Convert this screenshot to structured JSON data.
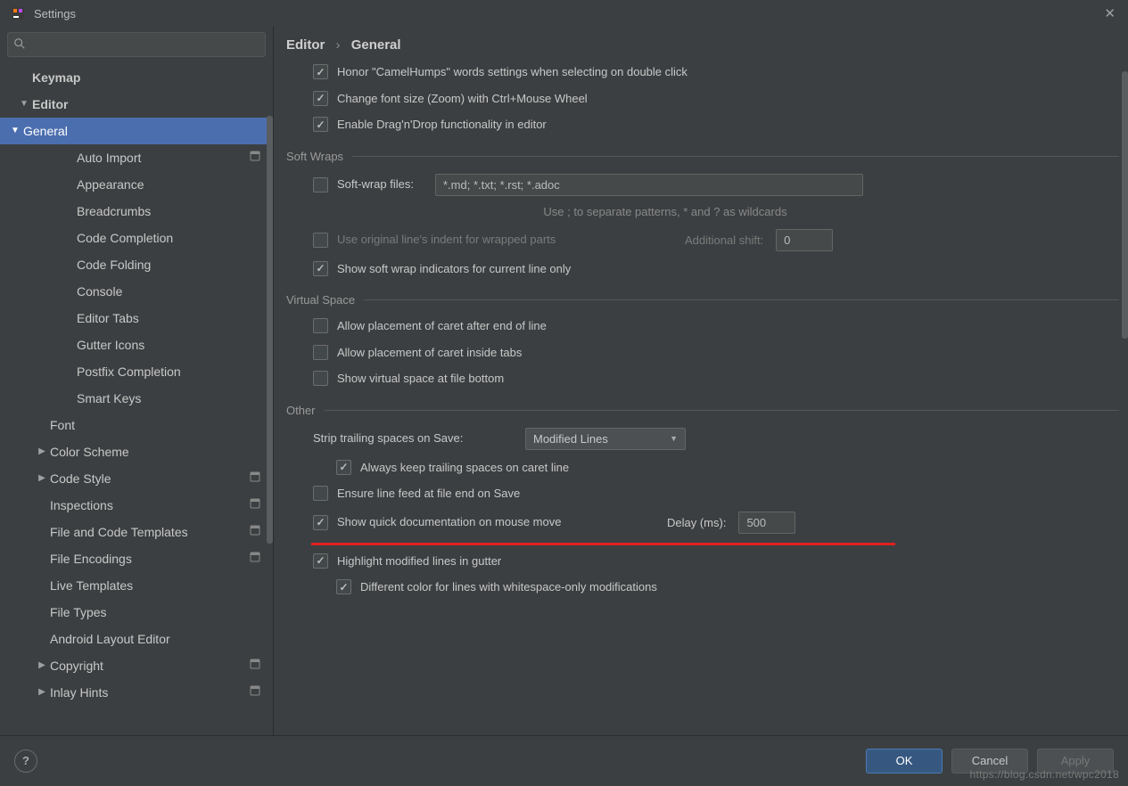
{
  "window": {
    "title": "Settings"
  },
  "search": {
    "placeholder": ""
  },
  "sidebar": {
    "items": [
      {
        "label": "Keymap",
        "indent": 1,
        "arrow": "",
        "bold": true
      },
      {
        "label": "Editor",
        "indent": 1,
        "arrow": "▼",
        "bold": true
      },
      {
        "label": "General",
        "indent": 2,
        "arrow": "▼",
        "selected": true
      },
      {
        "label": "Auto Import",
        "indent": 3,
        "badge": true
      },
      {
        "label": "Appearance",
        "indent": 3
      },
      {
        "label": "Breadcrumbs",
        "indent": 3
      },
      {
        "label": "Code Completion",
        "indent": 3
      },
      {
        "label": "Code Folding",
        "indent": 3
      },
      {
        "label": "Console",
        "indent": 3
      },
      {
        "label": "Editor Tabs",
        "indent": 3
      },
      {
        "label": "Gutter Icons",
        "indent": 3
      },
      {
        "label": "Postfix Completion",
        "indent": 3
      },
      {
        "label": "Smart Keys",
        "indent": 3
      },
      {
        "label": "Font",
        "indent": 2
      },
      {
        "label": "Color Scheme",
        "indent": 2,
        "arrow": "▶"
      },
      {
        "label": "Code Style",
        "indent": 2,
        "arrow": "▶",
        "badge": true
      },
      {
        "label": "Inspections",
        "indent": 2,
        "badge": true
      },
      {
        "label": "File and Code Templates",
        "indent": 2,
        "badge": true
      },
      {
        "label": "File Encodings",
        "indent": 2,
        "badge": true
      },
      {
        "label": "Live Templates",
        "indent": 2
      },
      {
        "label": "File Types",
        "indent": 2
      },
      {
        "label": "Android Layout Editor",
        "indent": 2
      },
      {
        "label": "Copyright",
        "indent": 2,
        "arrow": "▶",
        "badge": true
      },
      {
        "label": "Inlay Hints",
        "indent": 2,
        "arrow": "▶",
        "badge": true
      }
    ]
  },
  "breadcrumb": {
    "part1": "Editor",
    "part2": "General"
  },
  "opts": {
    "camelHumps": "Honor \"CamelHumps\" words settings when selecting on double click",
    "zoom": "Change font size (Zoom) with Ctrl+Mouse Wheel",
    "dnd": "Enable Drag'n'Drop functionality in editor"
  },
  "sections": {
    "softWraps": "Soft Wraps",
    "virtualSpace": "Virtual Space",
    "other": "Other"
  },
  "softwrap": {
    "filesLabel": "Soft-wrap files:",
    "filesValue": "*.md; *.txt; *.rst; *.adoc",
    "hint": "Use ; to separate patterns, * and ? as wildcards",
    "useOriginal": "Use original line's indent for wrapped parts",
    "additionalShiftLabel": "Additional shift:",
    "additionalShiftValue": "0",
    "showIndicators": "Show soft wrap indicators for current line only"
  },
  "virtual": {
    "afterEol": "Allow placement of caret after end of line",
    "insideTabs": "Allow placement of caret inside tabs",
    "fileBottom": "Show virtual space at file bottom"
  },
  "other": {
    "stripLabel": "Strip trailing spaces on Save:",
    "stripValue": "Modified Lines",
    "alwaysKeep": "Always keep trailing spaces on caret line",
    "ensureLF": "Ensure line feed at file end on Save",
    "quickDoc": "Show quick documentation on mouse move",
    "delayLabel": "Delay (ms):",
    "delayValue": "500",
    "highlightModified": "Highlight modified lines in gutter",
    "diffColor": "Different color for lines with whitespace-only modifications"
  },
  "footer": {
    "ok": "OK",
    "cancel": "Cancel",
    "apply": "Apply"
  },
  "watermark": "https://blog.csdn.net/wpc2018"
}
